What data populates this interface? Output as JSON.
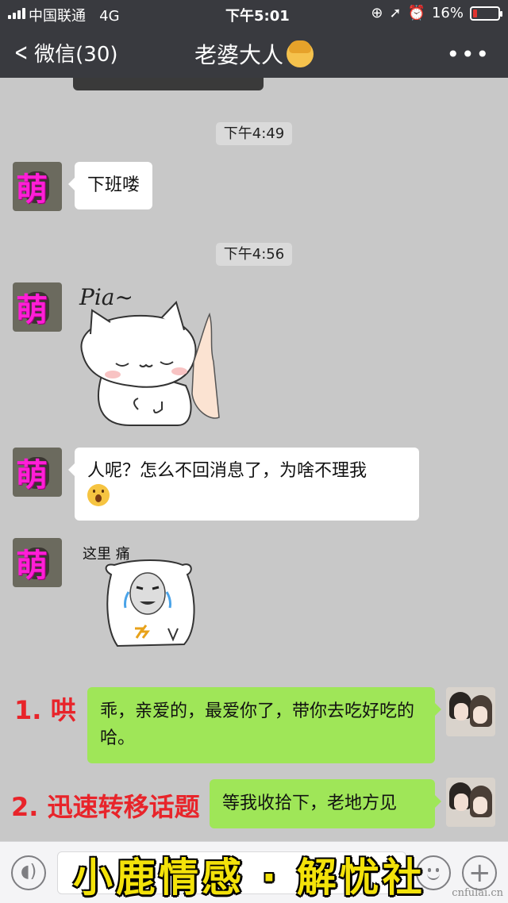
{
  "status_bar": {
    "carrier": "中国联通",
    "network": "4G",
    "time": "下午5:01",
    "battery": "16%",
    "battery_level": 0.16
  },
  "nav": {
    "back_label": "微信(30)",
    "title": "老婆大人",
    "title_emoji": "woman-emoji",
    "more_label": "•••"
  },
  "messages": {
    "ts1": "下午4:49",
    "msg1": "下班喽",
    "ts2": "下午4:56",
    "sticker1_text": "Pia~",
    "msg2": "人呢？怎么不回消息了，为啥不理我",
    "msg2_emoji": "astonished-face",
    "sticker2_caption": "这里 痛",
    "reply1": "乖，亲爱的，最爱你了，带你去吃好吃的哈。",
    "reply2": "等我收拾下，老地方见"
  },
  "avatar_overlay": "萌",
  "annotations": {
    "a1": "1. 哄",
    "a2": "2. 迅速转移话题"
  },
  "watermark": "小鹿情感 · 解忧社",
  "site": "cnfulai.cn",
  "colors": {
    "header": "#393a3f",
    "chat_bg": "#c8c8c8",
    "bubble_self": "#9fe658",
    "bubble_other": "#ffffff",
    "annotation": "#e8242a",
    "watermark": "#f3e20a"
  }
}
